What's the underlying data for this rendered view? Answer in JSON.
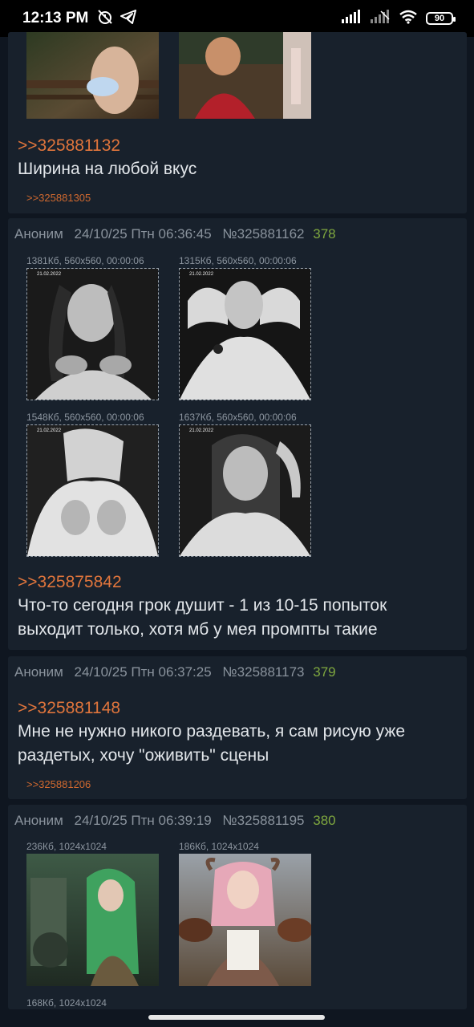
{
  "status": {
    "time": "12:13 PM",
    "battery": "90",
    "icons": [
      "alarm-off-icon",
      "telegram-icon",
      "signal-icon",
      "signal-icon-2",
      "wifi-icon",
      "battery-icon"
    ]
  },
  "posts": [
    {
      "quote": ">>325881132",
      "text": "Ширина на любой вкус",
      "reply": ">>325881305"
    },
    {
      "author": "Аноним",
      "date": "24/10/25 Птн 06:36:45",
      "number": "№325881162",
      "count": "378",
      "files": [
        {
          "meta": "1381Кб, 560x560, 00:00:06",
          "stamp": "21.02.2022"
        },
        {
          "meta": "1315Кб, 560x560, 00:00:06",
          "stamp": "21.02.2022"
        },
        {
          "meta": "1548Кб, 560x560, 00:00:06",
          "stamp": "21.02.2022"
        },
        {
          "meta": "1637Кб, 560x560, 00:00:06",
          "stamp": "21.02.2022"
        }
      ],
      "quote": ">>325875842",
      "text_line1": "Что-то сегодня грок душит - 1 из 10-15 попыток",
      "text_line2": "выходит только, хотя мб у мея промпты такие"
    },
    {
      "author": "Аноним",
      "date": "24/10/25 Птн 06:37:25",
      "number": "№325881173",
      "count": "379",
      "quote": ">>325881148",
      "text_line1": "Мне не нужно никого раздевать, я сам рисую уже",
      "text_line2": "раздетых, хочу \"оживить\" сцены",
      "reply": ">>325881206"
    },
    {
      "author": "Аноним",
      "date": "24/10/25 Птн 06:39:19",
      "number": "№325881195",
      "count": "380",
      "files": [
        {
          "meta": "236Кб, 1024x1024"
        },
        {
          "meta": "186Кб, 1024x1024"
        },
        {
          "meta": "168Кб, 1024x1024"
        }
      ]
    }
  ],
  "colors": {
    "background": "#0f1620",
    "post_bg": "#18212c",
    "quote": "#e0753c",
    "count": "#7fa83f",
    "header": "#8a939d"
  }
}
